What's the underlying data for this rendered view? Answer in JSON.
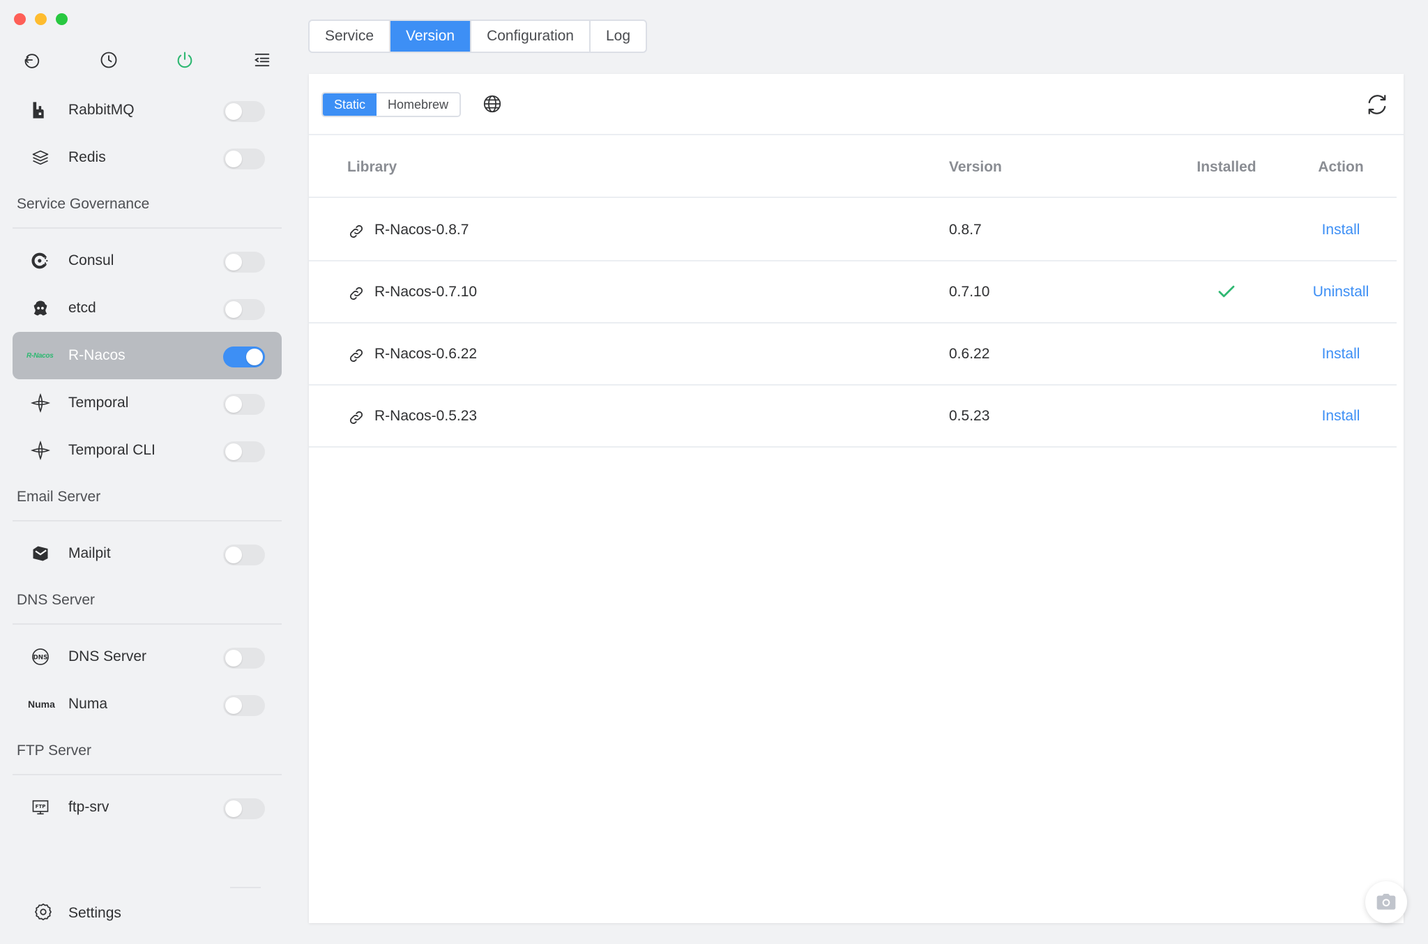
{
  "window": {
    "traffic_lights": [
      "close",
      "minimize",
      "zoom"
    ]
  },
  "top_icons": [
    "back-icon",
    "clock-icon",
    "power-icon",
    "menu-icon"
  ],
  "colors": {
    "accent": "#3d8ff5",
    "power": "#2fb872",
    "check": "#2fb872",
    "active_item_bg": "#b9bcc1"
  },
  "sidebar": {
    "items_top": [
      {
        "label": "RabbitMQ",
        "icon": "rabbitmq-icon",
        "on": false
      },
      {
        "label": "Redis",
        "icon": "redis-icon",
        "on": false
      }
    ],
    "sections": [
      {
        "title": "Service Governance",
        "items": [
          {
            "label": "Consul",
            "icon": "consul-icon",
            "on": false
          },
          {
            "label": "etcd",
            "icon": "etcd-icon",
            "on": false
          },
          {
            "label": "R-Nacos",
            "icon": "r-nacos-logo",
            "logo_text": "R-Nacos",
            "on": true,
            "active": true
          },
          {
            "label": "Temporal",
            "icon": "temporal-icon",
            "on": false
          },
          {
            "label": "Temporal CLI",
            "icon": "temporal-icon",
            "on": false
          }
        ]
      },
      {
        "title": "Email Server",
        "items": [
          {
            "label": "Mailpit",
            "icon": "mailpit-icon",
            "on": false
          }
        ]
      },
      {
        "title": "DNS Server",
        "items": [
          {
            "label": "DNS Server",
            "icon": "dns-icon",
            "on": false
          },
          {
            "label": "Numa",
            "icon": "numa-logo",
            "logo_text": "Numa",
            "on": false
          }
        ]
      },
      {
        "title": "FTP Server",
        "items": [
          {
            "label": "ftp-srv",
            "icon": "ftp-icon",
            "on": false
          }
        ]
      }
    ],
    "settings_label": "Settings"
  },
  "tabs": [
    {
      "label": "Service",
      "active": false
    },
    {
      "label": "Version",
      "active": true
    },
    {
      "label": "Configuration",
      "active": false
    },
    {
      "label": "Log",
      "active": false
    }
  ],
  "source_toggle": {
    "options": [
      "Static",
      "Homebrew"
    ],
    "selected": "Static"
  },
  "table": {
    "headers": {
      "library": "Library",
      "version": "Version",
      "installed": "Installed",
      "action": "Action"
    },
    "rows": [
      {
        "library": "R-Nacos-0.8.7",
        "version": "0.8.7",
        "installed": false,
        "action": "Install"
      },
      {
        "library": "R-Nacos-0.7.10",
        "version": "0.7.10",
        "installed": true,
        "action": "Uninstall"
      },
      {
        "library": "R-Nacos-0.6.22",
        "version": "0.6.22",
        "installed": false,
        "action": "Install"
      },
      {
        "library": "R-Nacos-0.5.23",
        "version": "0.5.23",
        "installed": false,
        "action": "Install"
      }
    ]
  }
}
